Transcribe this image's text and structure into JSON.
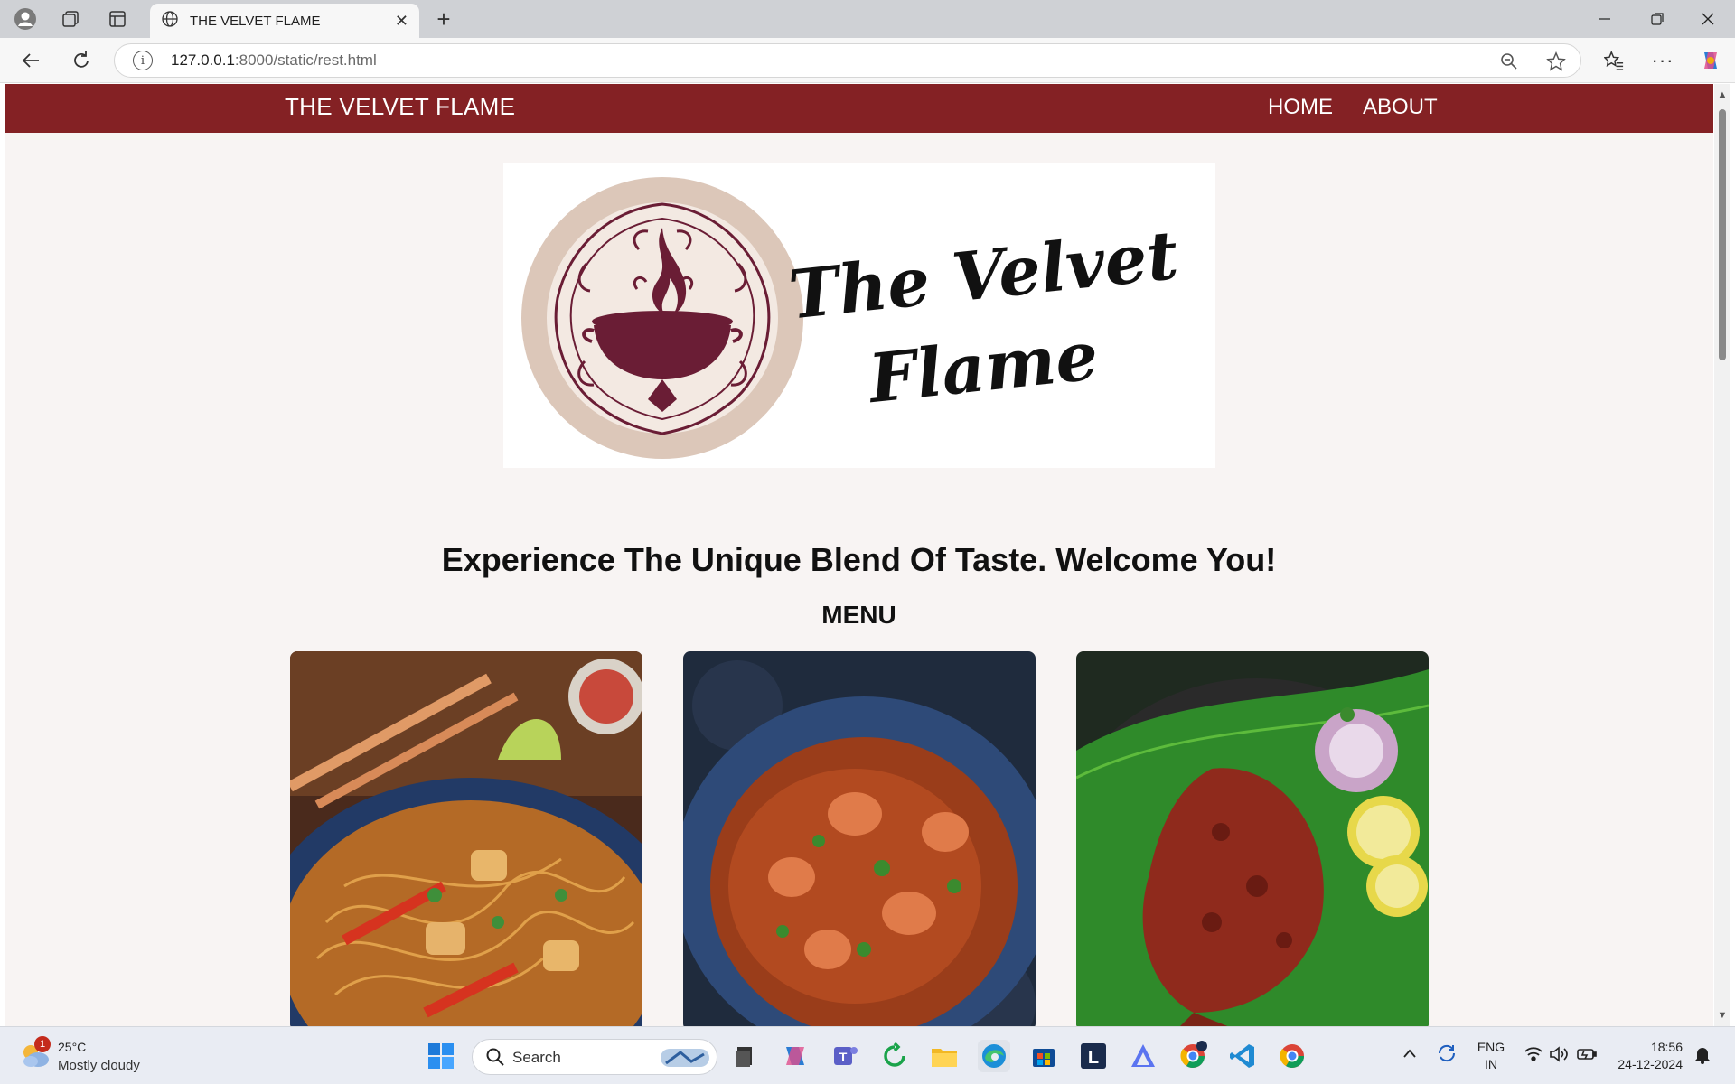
{
  "browser": {
    "tab_title": "THE VELVET FLAME",
    "url_host": "127.0.0.1",
    "url_rest": ":8000/static/rest.html"
  },
  "site": {
    "brand": "THE VELVET FLAME",
    "nav": [
      "HOME",
      "ABOUT"
    ],
    "logo_text_line1": "The Velvet",
    "logo_text_line2": "Flame",
    "tagline": "Experience The Unique Blend Of Taste. Welcome You!",
    "menu_heading": "MENU",
    "dishes": [
      "noodles-photo",
      "shrimp-curry-photo",
      "fish-fry-photo"
    ],
    "colors": {
      "nav_bg": "#842124",
      "page_bg": "#f8f4f3",
      "logo_circle": "#dcc7b9",
      "logo_ink": "#6a1d35"
    }
  },
  "taskbar": {
    "weather_temp": "25°C",
    "weather_desc": "Mostly cloudy",
    "weather_badge": "1",
    "search_label": "Search",
    "lang_line1": "ENG",
    "lang_line2": "IN",
    "time": "18:56",
    "date": "24-12-2024"
  }
}
